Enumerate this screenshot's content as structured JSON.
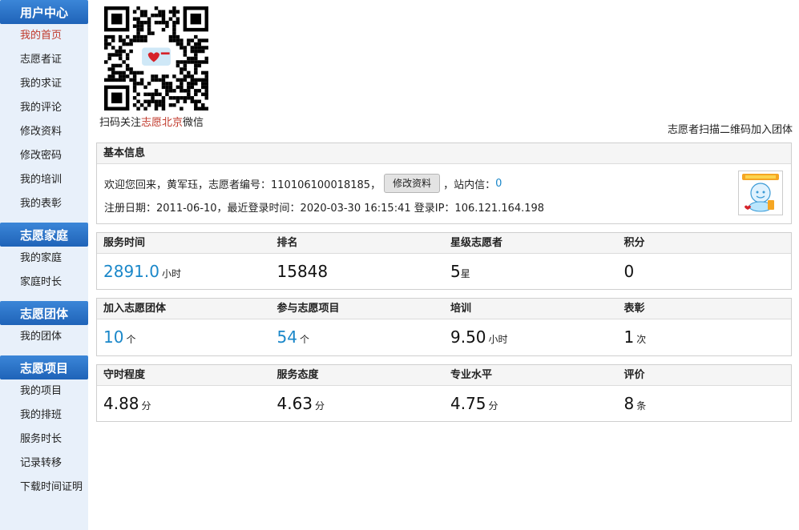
{
  "sidebar": {
    "groups": [
      {
        "title": "用户中心",
        "items": [
          "我的首页",
          "志愿者证",
          "我的求证",
          "我的评论",
          "修改资料",
          "修改密码",
          "我的培训",
          "我的表彰"
        ]
      },
      {
        "title": "志愿家庭",
        "items": [
          "我的家庭",
          "家庭时长"
        ]
      },
      {
        "title": "志愿团体",
        "items": [
          "我的团体"
        ]
      },
      {
        "title": "志愿项目",
        "items": [
          "我的项目",
          "我的排班",
          "服务时长",
          "记录转移",
          "下载时间证明"
        ]
      }
    ]
  },
  "qr": {
    "caption_prefix": "扫码关注",
    "caption_highlight": "志愿北京",
    "caption_suffix": "微信"
  },
  "join_text": "志愿者扫描二维码加入团体",
  "basic": {
    "title": "基本信息",
    "welcome": "欢迎您回来，黄军珏，志愿者编号：110106100018185，",
    "edit_button": "修改资料",
    "message_label": "，站内信：",
    "message_count": "0",
    "register_info": "注册日期：2011-06-10，最近登录时间：2020-03-30 16:15:41   登录IP：106.121.164.198"
  },
  "stats1": {
    "headers": [
      "服务时间",
      "排名",
      "星级志愿者",
      "积分"
    ],
    "service_hours": "2891.0",
    "service_unit": "小时",
    "rank": "15848",
    "stars": "5",
    "stars_unit": "星",
    "points": "0"
  },
  "stats2": {
    "headers": [
      "加入志愿团体",
      "参与志愿项目",
      "培训",
      "表彰"
    ],
    "groups": "10",
    "groups_unit": "个",
    "projects": "54",
    "projects_unit": "个",
    "training": "9.50",
    "training_unit": "小时",
    "awards": "1",
    "awards_unit": "次"
  },
  "stats3": {
    "headers": [
      "守时程度",
      "服务态度",
      "专业水平",
      "评价"
    ],
    "punctuality": "4.88",
    "punctuality_unit": "分",
    "attitude": "4.63",
    "attitude_unit": "分",
    "skill": "4.75",
    "skill_unit": "分",
    "reviews": "8",
    "reviews_unit": "条"
  }
}
